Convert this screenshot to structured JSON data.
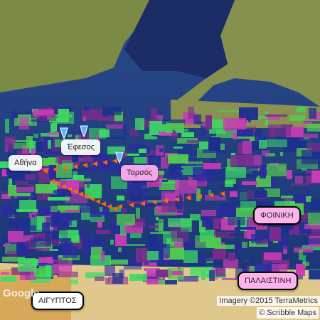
{
  "map": {
    "base_layer": "satellite",
    "places": [
      {
        "key": "athens",
        "label": "Αθήνα",
        "style": "light"
      },
      {
        "key": "ephesus",
        "label": "Έφεσος",
        "style": "light"
      },
      {
        "key": "tarsus",
        "label": "Ταρσός",
        "style": "pink"
      },
      {
        "key": "phoenicia",
        "label": "ΦΟΙΝΙΚΗ",
        "style": "darkpink"
      },
      {
        "key": "palestine",
        "label": "ΠΑΛΑΙΣΤΙΝΗ",
        "style": "darkpink"
      },
      {
        "key": "egypt",
        "label": "ΑΙΓΥΠΤΟΣ",
        "style": "dark"
      }
    ],
    "route_color": "#ff6a00",
    "colors": {
      "sea": "#1f3c7a",
      "land": "#7a8a3a",
      "noise_magenta": "#c83cb4",
      "noise_green": "#3cdc64",
      "noise_navy": "#1c2f8f"
    }
  },
  "attribution": "Imagery ©2015 TerraMetrics",
  "scribble": "© Scribble Maps",
  "google_logo": "Google"
}
